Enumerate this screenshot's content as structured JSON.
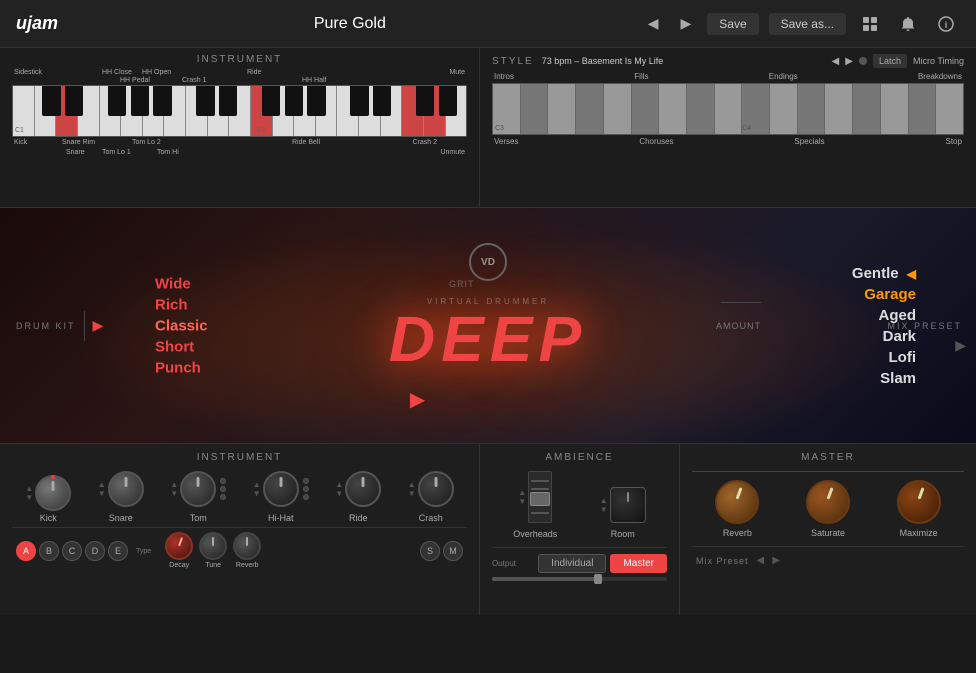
{
  "app": {
    "logo": "ujam",
    "preset": "Pure Gold",
    "save_label": "Save",
    "save_as_label": "Save as..."
  },
  "instrument_panel": {
    "title": "INSTRUMENT",
    "top_labels": [
      "Sidestick",
      "HH Close",
      "HH Open",
      "Ride",
      "Mute"
    ],
    "sub_labels": [
      "HH Pedal",
      "Crash 1",
      "HH Half"
    ],
    "bottom_labels": [
      "Kick",
      "Snare Rim",
      "Tom Lo 2",
      "Ride Bell",
      "Crash 2"
    ],
    "sub_bottom": [
      "Snare",
      "Tom Lo 1",
      "Tom Hi",
      "Unmute"
    ],
    "c_labels": [
      "C1",
      "C2"
    ]
  },
  "style_panel": {
    "title": "STYLE",
    "bpm_text": "73 bpm – Basement Is My Life",
    "latch_label": "Latch",
    "micro_timing_label": "Micro Timing",
    "section_labels": [
      "Intros",
      "Fills",
      "Endings",
      "Breakdowns"
    ],
    "bottom_labels": [
      "Verses",
      "Choruses",
      "Specials",
      "Stop"
    ],
    "c_labels": [
      "C3",
      "C4"
    ]
  },
  "drum_kit": {
    "label": "DRUM KIT",
    "styles": [
      "Wide",
      "Rich",
      "Classic",
      "Short",
      "Punch"
    ],
    "active_style": "Classic",
    "grit_label": "Grit",
    "vd_label": "VD",
    "virtual_drummer": "VIRTUAL DRUMMER",
    "product_name": "DEEP",
    "amount_label": "Amount",
    "arrow_label": "▶"
  },
  "mix_preset": {
    "label": "MIX PRESET",
    "styles": [
      "Gentle",
      "Garage",
      "Aged",
      "Dark",
      "Lofi",
      "Slam"
    ],
    "active_style": "Garage"
  },
  "instrument_controls": {
    "title": "INSTRUMENT",
    "knobs": [
      {
        "label": "Kick",
        "active": true
      },
      {
        "label": "Snare",
        "active": false
      },
      {
        "label": "Tom",
        "active": false
      },
      {
        "label": "Hi-Hat",
        "active": false
      },
      {
        "label": "Ride",
        "active": false
      },
      {
        "label": "Crash",
        "active": false
      }
    ],
    "type_buttons": [
      "A",
      "B",
      "C",
      "D",
      "E"
    ],
    "type_label": "Type",
    "bottom_knobs": [
      {
        "label": "Decay"
      },
      {
        "label": "Tune"
      },
      {
        "label": "Reverb"
      }
    ]
  },
  "ambience_controls": {
    "title": "AMBIENCE",
    "knobs": [
      {
        "label": "Overheads"
      },
      {
        "label": "Room"
      }
    ],
    "output_label": "Output",
    "individual_label": "Individual",
    "master_label": "Master"
  },
  "master_controls": {
    "title": "MASTER",
    "knobs": [
      {
        "label": "Reverb"
      },
      {
        "label": "Saturate"
      },
      {
        "label": "Maximize"
      }
    ],
    "mix_preset_label": "Mix Preset"
  }
}
